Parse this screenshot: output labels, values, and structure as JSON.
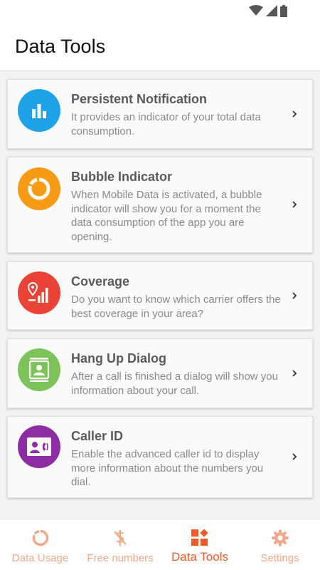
{
  "app": {
    "title": "Data Tools"
  },
  "status_bar": {
    "icons": [
      "wifi-icon",
      "cell-signal-icon",
      "battery-icon"
    ]
  },
  "colors": {
    "accent": "#ee5a28",
    "accent_inactive": "#f1a98c",
    "icon_blue": "#1fa3e8",
    "icon_orange": "#f79a16",
    "icon_red": "#eb4337",
    "icon_green": "#7dc35a",
    "icon_purple": "#8e2da3"
  },
  "tools": [
    {
      "title": "Persistent Notification",
      "description": "It provides an indicator of your total data consumption.",
      "icon": "bar-chart-icon"
    },
    {
      "title": "Bubble Indicator",
      "description": "When Mobile Data is activated, a bubble indicator will show you for a moment the data consumption of the app you are opening.",
      "icon": "ring-icon"
    },
    {
      "title": "Coverage",
      "description": "Do you want to know which carrier offers the best coverage in your area?",
      "icon": "location-signal-icon"
    },
    {
      "title": "Hang Up Dialog",
      "description": "After a call is finished a dialog will show you information about your call.",
      "icon": "contact-card-icon"
    },
    {
      "title": "Caller ID",
      "description": "Enable the advanced caller id to display more information about the numbers you dial.",
      "icon": "caller-id-icon"
    }
  ],
  "bottom_nav": {
    "items": [
      {
        "label": "Data Usage",
        "icon": "ring-icon",
        "active": false
      },
      {
        "label": "Free numbers",
        "icon": "no-dollar-icon",
        "active": false
      },
      {
        "label": "Data Tools",
        "icon": "tools-grid-icon",
        "active": true
      },
      {
        "label": "Settings",
        "icon": "gear-icon",
        "active": false
      }
    ]
  }
}
